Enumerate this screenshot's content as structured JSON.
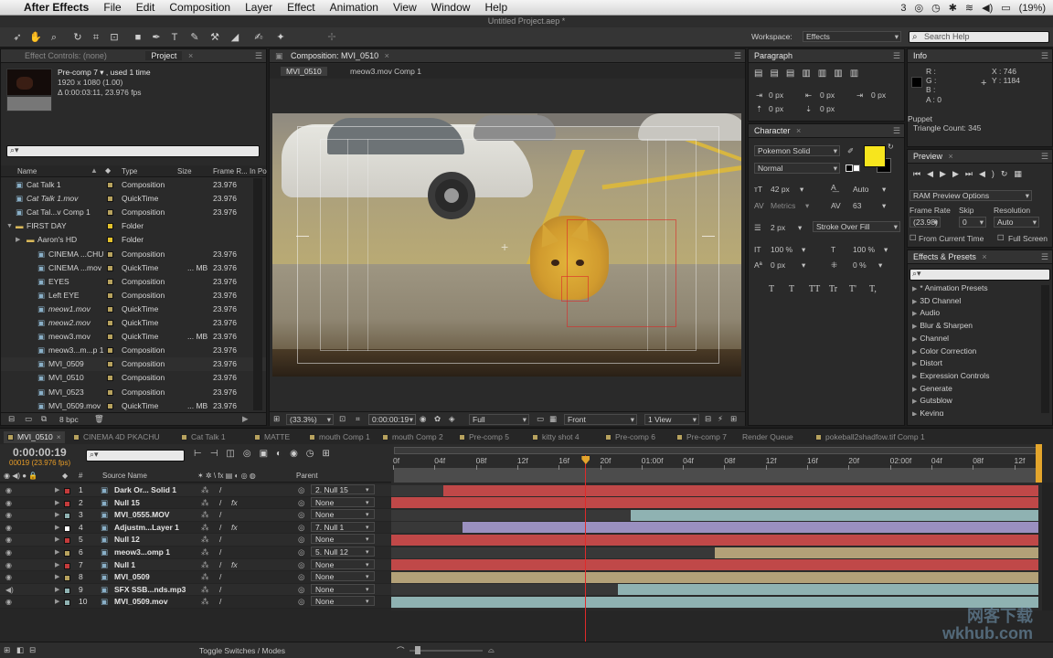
{
  "menubar": {
    "app": "After Effects",
    "items": [
      "File",
      "Edit",
      "Composition",
      "Layer",
      "Effect",
      "Animation",
      "View",
      "Window",
      "Help"
    ],
    "status_badge": "3",
    "battery": "(19%)"
  },
  "window_title": "Untitled Project.aep *",
  "workspace": {
    "label": "Workspace:",
    "value": "Effects"
  },
  "help_search": "Search Help",
  "effect_controls_tab": "Effect Controls: (none)",
  "project_tab": "Project",
  "project_info": {
    "name": "Pre-comp 7 ▾ , used 1 time",
    "size": "1920 x 1080 (1.00)",
    "duration": "Δ 0:00:03:11, 23.976 fps"
  },
  "project_columns": [
    "Name",
    "Type",
    "Size",
    "Frame R...",
    "In Po"
  ],
  "project_items": [
    {
      "name": "Cat Talk 1",
      "type": "Composition",
      "size": "",
      "fps": "23.976",
      "color": "#b7a25e",
      "italic": false
    },
    {
      "name": "Cat Talk 1.mov",
      "type": "QuickTime",
      "size": "",
      "fps": "23.976",
      "color": "#b7a25e",
      "italic": true
    },
    {
      "name": "Cat Tal...v Comp 1",
      "type": "Composition",
      "size": "",
      "fps": "23.976",
      "color": "#b7a25e",
      "italic": false
    },
    {
      "name": "FIRST DAY",
      "type": "Folder",
      "size": "",
      "fps": "",
      "color": "#e3c22c",
      "italic": false
    },
    {
      "name": "Aaron's HD",
      "type": "Folder",
      "size": "",
      "fps": "",
      "color": "#e3c22c",
      "italic": false
    },
    {
      "name": "CINEMA ...CHU",
      "type": "Composition",
      "size": "",
      "fps": "23.976",
      "color": "#b7a25e",
      "italic": false
    },
    {
      "name": "CINEMA ...mov",
      "type": "QuickTime",
      "size": "... MB",
      "fps": "23.976",
      "color": "#b7a25e",
      "italic": false
    },
    {
      "name": "EYES",
      "type": "Composition",
      "size": "",
      "fps": "23.976",
      "color": "#b7a25e",
      "italic": false
    },
    {
      "name": "Left EYE",
      "type": "Composition",
      "size": "",
      "fps": "23.976",
      "color": "#b7a25e",
      "italic": false
    },
    {
      "name": "meow1.mov",
      "type": "QuickTime",
      "size": "",
      "fps": "23.976",
      "color": "#b7a25e",
      "italic": true
    },
    {
      "name": "meow2.mov",
      "type": "QuickTime",
      "size": "",
      "fps": "23.976",
      "color": "#b7a25e",
      "italic": true
    },
    {
      "name": "meow3.mov",
      "type": "QuickTime",
      "size": "... MB",
      "fps": "23.976",
      "color": "#b7a25e",
      "italic": false
    },
    {
      "name": "meow3...m...p 1",
      "type": "Composition",
      "size": "",
      "fps": "23.976",
      "color": "#b7a25e",
      "italic": false
    },
    {
      "name": "MVI_0509",
      "type": "Composition",
      "size": "",
      "fps": "23.976",
      "color": "#b7a25e",
      "italic": false
    },
    {
      "name": "MVI_0510",
      "type": "Composition",
      "size": "",
      "fps": "23.976",
      "color": "#b7a25e",
      "italic": false
    },
    {
      "name": "MVI_0523",
      "type": "Composition",
      "size": "",
      "fps": "23.976",
      "color": "#b7a25e",
      "italic": false
    },
    {
      "name": "MVI_0509.mov",
      "type": "QuickTime",
      "size": "... MB",
      "fps": "23.976",
      "color": "#b7a25e",
      "italic": false
    }
  ],
  "project_bpc": "8 bpc",
  "comp_tab": "Composition: MVI_0510",
  "comp_crumbs": [
    "MVI_0510",
    "meow3.mov Comp 1"
  ],
  "viewer_footer": {
    "zoom": "(33.3%)",
    "timecode": "0:00:00:19",
    "resolution": "Full",
    "view": "Front",
    "views": "1 View"
  },
  "paragraph": {
    "tab": "Paragraph",
    "indent_values": [
      "0 px",
      "0 px",
      "0 px",
      "0 px",
      "0 px"
    ]
  },
  "character": {
    "tab": "Character",
    "font": "Pokemon Solid",
    "style": "Normal",
    "size": "42 px",
    "leading": "Auto",
    "kerning": "Metrics",
    "tracking": "63",
    "stroke_width": "2 px",
    "stroke_type": "Stroke Over Fill",
    "vscale": "100 %",
    "hscale": "100 %",
    "baseline": "0 px",
    "tsume": "0 %",
    "fill_color": "#f7e51d",
    "style_buttons": [
      "T",
      "T",
      "TT",
      "Tr",
      "T'",
      "T,"
    ]
  },
  "info": {
    "tab": "Info",
    "r": "R :",
    "g": "G :",
    "b": "B :",
    "a": "A : 0",
    "x": "X : 746",
    "y": "Y : 1184",
    "note_title": "Puppet",
    "note": "Triangle Count: 345"
  },
  "preview": {
    "tab": "Preview",
    "options": "RAM Preview Options",
    "frame_rate_label": "Frame Rate",
    "skip_label": "Skip",
    "resolution_label": "Resolution",
    "frame_rate": "(23.98)",
    "skip": "0",
    "resolution": "Auto",
    "from_current": "From Current Time",
    "full_screen": "Full Screen"
  },
  "effects": {
    "tab": "Effects & Presets",
    "items": [
      "* Animation Presets",
      "3D Channel",
      "Audio",
      "Blur & Sharpen",
      "Channel",
      "Color Correction",
      "Distort",
      "Expression Controls",
      "Generate",
      "Gutsblow",
      "Keying"
    ]
  },
  "timeline_tabs": [
    {
      "label": "MVI_0510",
      "color": "#b7a25e",
      "active": true
    },
    {
      "label": "CINEMA 4D PKACHU",
      "color": "#b7a25e",
      "active": false
    },
    {
      "label": "Cat Talk 1",
      "color": "#b7a25e",
      "active": false
    },
    {
      "label": "MATTE",
      "color": "#b7a25e",
      "active": false
    },
    {
      "label": "mouth Comp 1",
      "color": "#b7a25e",
      "active": false
    },
    {
      "label": "mouth Comp 2",
      "color": "#b7a25e",
      "active": false
    },
    {
      "label": "Pre-comp 5",
      "color": "#b7a25e",
      "active": false
    },
    {
      "label": "kitty shot 4",
      "color": "#b7a25e",
      "active": false
    },
    {
      "label": "Pre-comp 6",
      "color": "#b7a25e",
      "active": false
    },
    {
      "label": "Pre-comp 7",
      "color": "#b7a25e",
      "active": false
    },
    {
      "label": "Render Queue",
      "color": "",
      "active": false
    },
    {
      "label": "pokeball2shadfow.tif Comp 1",
      "color": "#b7a25e",
      "active": false
    }
  ],
  "timecode": "0:00:00:19",
  "timecode_sub": "00019 (23.976 fps)",
  "layer_columns": {
    "source": "Source Name",
    "parent": "Parent"
  },
  "layers": [
    {
      "num": "1",
      "name": "Dark Or... Solid 1",
      "color": "#c43b3b",
      "parent": "2. Null 15",
      "fx": false,
      "start": 0.08,
      "end": 1.0,
      "bar": "#c04848"
    },
    {
      "num": "2",
      "name": "Null 15",
      "color": "#c43b3b",
      "parent": "None",
      "fx": true,
      "start": 0.0,
      "end": 1.0,
      "bar": "#c04848"
    },
    {
      "num": "3",
      "name": "MVI_0555.MOV",
      "color": "#8fb2b2",
      "parent": "None",
      "fx": false,
      "start": 0.37,
      "end": 1.0,
      "bar": "#8fb2b2"
    },
    {
      "num": "4",
      "name": "Adjustm...Layer 1",
      "color": "#ffffff",
      "parent": "7. Null 1",
      "fx": true,
      "start": 0.11,
      "end": 1.0,
      "bar": "#9a90c0"
    },
    {
      "num": "5",
      "name": "Null 12",
      "color": "#c43b3b",
      "parent": "None",
      "fx": false,
      "start": 0.0,
      "end": 1.0,
      "bar": "#c04848"
    },
    {
      "num": "6",
      "name": "meow3...omp 1",
      "color": "#b7a25e",
      "parent": "5. Null 12",
      "fx": false,
      "start": 0.5,
      "end": 1.0,
      "bar": "#b3a178"
    },
    {
      "num": "7",
      "name": "Null 1",
      "color": "#c43b3b",
      "parent": "None",
      "fx": true,
      "start": 0.0,
      "end": 1.0,
      "bar": "#c04848"
    },
    {
      "num": "8",
      "name": "MVI_0509",
      "color": "#b7a25e",
      "parent": "None",
      "fx": false,
      "start": 0.0,
      "end": 1.0,
      "bar": "#b3a178"
    },
    {
      "num": "9",
      "name": "SFX SSB...nds.mp3",
      "color": "#8fb2b2",
      "parent": "None",
      "fx": false,
      "start": 0.35,
      "end": 1.0,
      "bar": "#8fb2b2"
    },
    {
      "num": "10",
      "name": "MVI_0509.mov",
      "color": "#8fb2b2",
      "parent": "None",
      "fx": false,
      "start": 0.0,
      "end": 1.0,
      "bar": "#8fb2b2"
    }
  ],
  "ruler_ticks": [
    "0f",
    "04f",
    "08f",
    "12f",
    "16f",
    "20f",
    "01:00f",
    "04f",
    "08f",
    "12f",
    "16f",
    "20f",
    "02:00f",
    "04f",
    "08f",
    "12f"
  ],
  "playhead_fraction": 0.3,
  "toggle_label": "Toggle Switches / Modes",
  "watermark": "网客下载\nwkhub.com"
}
